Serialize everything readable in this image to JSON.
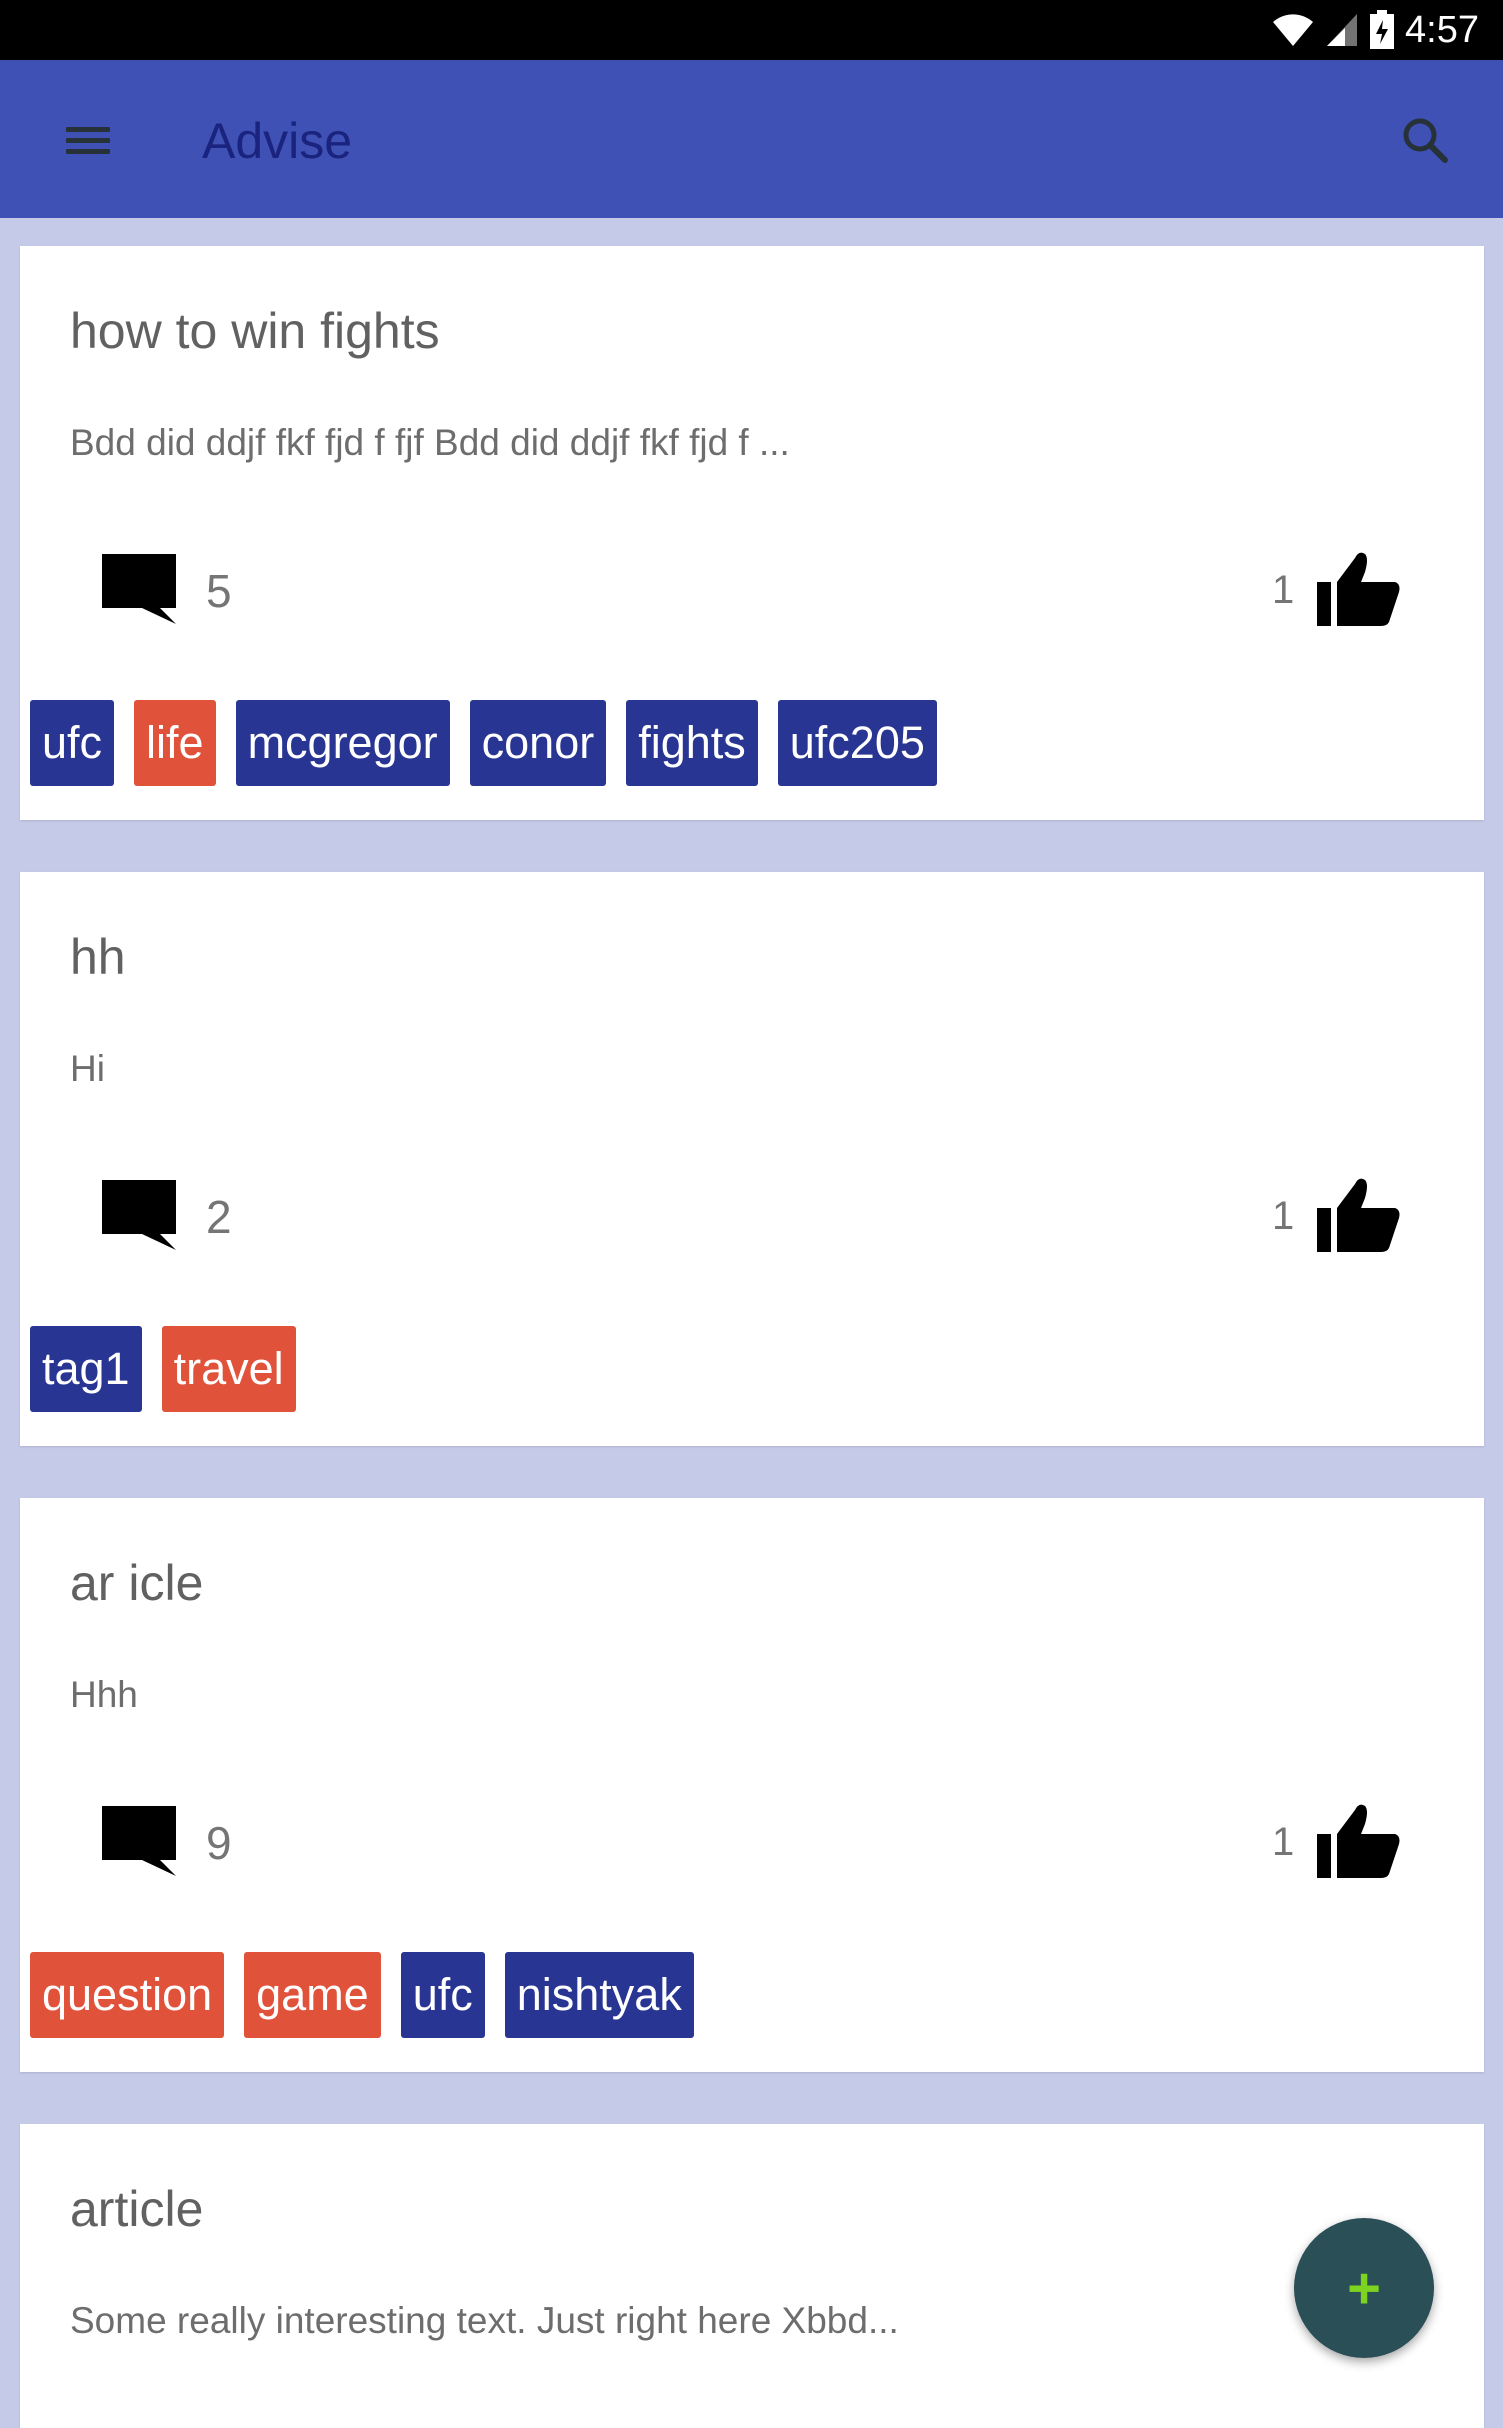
{
  "status_bar": {
    "time": "4:57"
  },
  "app_bar": {
    "title": "Advise",
    "menu_icon": "hamburger-menu-icon",
    "search_icon": "search-icon"
  },
  "posts": [
    {
      "title": "how to win fights",
      "body": "Bdd did ddjf fkf fjd f fjf Bdd did ddjf fkf fjd f ...",
      "comments": "5",
      "likes": "1",
      "tags": [
        {
          "label": "ufc",
          "color": "#283593"
        },
        {
          "label": "life",
          "color": "#e0523a"
        },
        {
          "label": "mcgregor",
          "color": "#283593"
        },
        {
          "label": "conor",
          "color": "#283593"
        },
        {
          "label": "fights",
          "color": "#283593"
        },
        {
          "label": "ufc205",
          "color": "#283593"
        }
      ]
    },
    {
      "title": "hh",
      "body": "Hi",
      "comments": "2",
      "likes": "1",
      "tags": [
        {
          "label": "tag1",
          "color": "#283593"
        },
        {
          "label": "travel",
          "color": "#e0523a"
        }
      ]
    },
    {
      "title": "ar icle",
      "body": "Hhh",
      "comments": "9",
      "likes": "1",
      "tags": [
        {
          "label": "question",
          "color": "#e0523a"
        },
        {
          "label": "game",
          "color": "#e0523a"
        },
        {
          "label": "ufc",
          "color": "#283593"
        },
        {
          "label": "nishtyak",
          "color": "#283593"
        }
      ]
    },
    {
      "title": "article",
      "body": "Some really interesting text. Just right here Xbbd..."
    }
  ],
  "fab": {
    "label": "+",
    "icon": "plus-icon"
  },
  "colors": {
    "primary": "#3f51b5",
    "background": "#c5cae9",
    "tag_blue": "#283593",
    "tag_red": "#e0523a",
    "fab": "#2a4f57",
    "fab_icon": "#7ed321"
  }
}
